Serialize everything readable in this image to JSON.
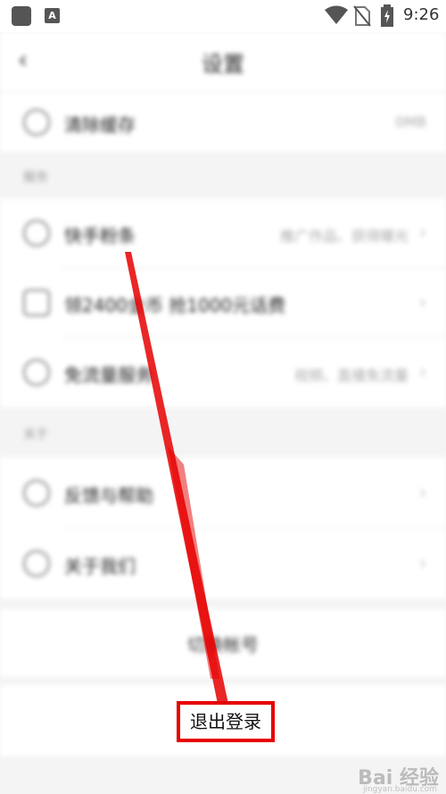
{
  "status_bar": {
    "time": "9:26",
    "icons": [
      "app-icon",
      "a-icon",
      "wifi-icon",
      "no-sim-icon",
      "battery-charging-icon"
    ],
    "a_glyph": "A"
  },
  "nav": {
    "title": "设置",
    "back_glyph": "‹"
  },
  "settings": [
    {
      "label": "清除缓存",
      "value": "0MB",
      "icon": "broom-icon"
    }
  ],
  "sections": [
    {
      "header": "服务",
      "items": [
        {
          "label": "快手粉条",
          "value": "推广作品、获得曝光",
          "icon": "rocket-icon"
        },
        {
          "label": "领2400金币 抢1000元话费",
          "value": "",
          "icon": "ticket-icon"
        },
        {
          "label": "免流量服务",
          "value": "视频、直播免流量",
          "icon": "data-free-icon"
        }
      ]
    },
    {
      "header": "关于",
      "items": [
        {
          "label": "反馈与帮助",
          "value": "",
          "icon": "help-icon"
        },
        {
          "label": "关于我们",
          "value": "",
          "icon": "info-icon"
        }
      ]
    }
  ],
  "switch_account": "切换帐号",
  "logout": "退出登录",
  "chevron": "›",
  "colors": {
    "highlight": "#e60000",
    "background": "#f4f4f4"
  },
  "watermark": {
    "brand": "Bai 经验",
    "domain": "jingyan.baidu.com"
  }
}
